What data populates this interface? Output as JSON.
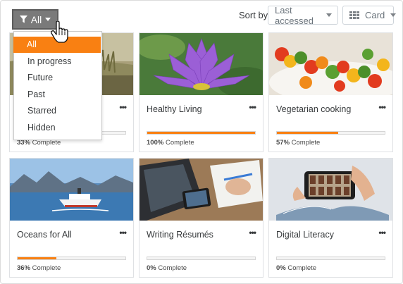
{
  "filter": {
    "label": "All",
    "icon": "filter-icon"
  },
  "filter_menu": {
    "items": [
      {
        "label": "All",
        "active": true
      },
      {
        "label": "In progress",
        "active": false
      },
      {
        "label": "Future",
        "active": false
      },
      {
        "label": "Past",
        "active": false
      },
      {
        "label": "Starred",
        "active": false
      },
      {
        "label": "Hidden",
        "active": false
      }
    ]
  },
  "sort": {
    "label": "Sort by",
    "value": "Last accessed"
  },
  "view": {
    "value": "Card",
    "icon": "grid-icon"
  },
  "accent_color": "#f98012",
  "courses": [
    {
      "title": "",
      "progress": 0.33,
      "percent_text": "33%",
      "complete_label": "Complete",
      "menu_label": "•••"
    },
    {
      "title": "Healthy Living",
      "progress": 1.0,
      "percent_text": "100%",
      "complete_label": "Complete",
      "menu_label": "•••"
    },
    {
      "title": "Vegetarian cooking",
      "progress": 0.57,
      "percent_text": "57%",
      "complete_label": "Complete",
      "menu_label": "•••"
    },
    {
      "title": "Oceans for All",
      "progress": 0.36,
      "percent_text": "36%",
      "complete_label": "Complete",
      "menu_label": "•••"
    },
    {
      "title": "Writing Résumés",
      "progress": 0.0,
      "percent_text": "0%",
      "complete_label": "Complete",
      "menu_label": "•••"
    },
    {
      "title": "Digital Literacy",
      "progress": 0.0,
      "percent_text": "0%",
      "complete_label": "Complete",
      "menu_label": "•••"
    }
  ]
}
